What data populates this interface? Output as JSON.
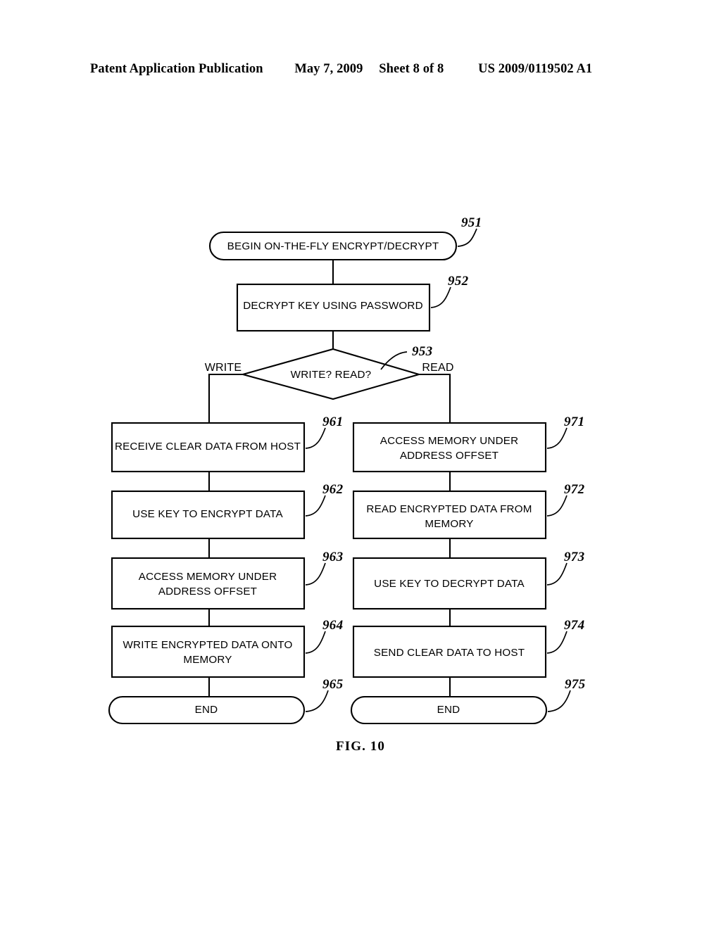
{
  "document": {
    "header": {
      "publication": "Patent Application Publication",
      "date": "May 7, 2009",
      "sheet": "Sheet 8 of 8",
      "patent_number": "US 2009/0119502 A1"
    },
    "figure_caption": "FIG. 10"
  },
  "chart_data": {
    "type": "diagram",
    "diagram_kind": "flowchart",
    "title": "FIG. 10",
    "nodes": [
      {
        "id": "951",
        "ref": "951",
        "shape": "terminator",
        "text": "BEGIN ON-THE-FLY ENCRYPT/DECRYPT",
        "lines": [
          "BEGIN ON-THE-FLY ENCRYPT/DECRYPT"
        ]
      },
      {
        "id": "952",
        "ref": "952",
        "shape": "process",
        "text": "DECRYPT KEY USING PASSWORD",
        "lines": [
          "DECRYPT KEY USING PASSWORD"
        ]
      },
      {
        "id": "953",
        "ref": "953",
        "shape": "decision",
        "text": "WRITE? READ?",
        "lines": [
          "WRITE? READ?"
        ]
      },
      {
        "id": "961",
        "ref": "961",
        "shape": "process",
        "text": "RECEIVE CLEAR DATA FROM HOST",
        "lines": [
          "RECEIVE CLEAR DATA FROM HOST"
        ]
      },
      {
        "id": "962",
        "ref": "962",
        "shape": "process",
        "text": "USE KEY TO ENCRYPT DATA",
        "lines": [
          "USE KEY TO ENCRYPT DATA"
        ]
      },
      {
        "id": "963",
        "ref": "963",
        "shape": "process",
        "text": "ACCESS MEMORY UNDER ADDRESS OFFSET",
        "lines": [
          "ACCESS MEMORY UNDER",
          "ADDRESS OFFSET"
        ]
      },
      {
        "id": "964",
        "ref": "964",
        "shape": "process",
        "text": "WRITE ENCRYPTED DATA ONTO MEMORY",
        "lines": [
          "WRITE ENCRYPTED DATA ONTO",
          "MEMORY"
        ]
      },
      {
        "id": "965",
        "ref": "965",
        "shape": "terminator",
        "text": "END",
        "lines": [
          "END"
        ]
      },
      {
        "id": "971",
        "ref": "971",
        "shape": "process",
        "text": "ACCESS MEMORY UNDER ADDRESS OFFSET",
        "lines": [
          "ACCESS MEMORY UNDER",
          "ADDRESS OFFSET"
        ]
      },
      {
        "id": "972",
        "ref": "972",
        "shape": "process",
        "text": "READ ENCRYPTED DATA FROM MEMORY",
        "lines": [
          "READ ENCRYPTED DATA FROM",
          "MEMORY"
        ]
      },
      {
        "id": "973",
        "ref": "973",
        "shape": "process",
        "text": "USE KEY TO DECRYPT DATA",
        "lines": [
          "USE KEY TO DECRYPT DATA"
        ]
      },
      {
        "id": "974",
        "ref": "974",
        "shape": "process",
        "text": "SEND CLEAR DATA TO HOST",
        "lines": [
          "SEND CLEAR DATA TO HOST"
        ]
      },
      {
        "id": "975",
        "ref": "975",
        "shape": "terminator",
        "text": "END",
        "lines": [
          "END"
        ]
      }
    ],
    "edges": [
      {
        "from": "951",
        "to": "952",
        "label": ""
      },
      {
        "from": "952",
        "to": "953",
        "label": ""
      },
      {
        "from": "953",
        "to": "961",
        "label": "WRITE"
      },
      {
        "from": "953",
        "to": "971",
        "label": "READ"
      },
      {
        "from": "961",
        "to": "962",
        "label": ""
      },
      {
        "from": "962",
        "to": "963",
        "label": ""
      },
      {
        "from": "963",
        "to": "964",
        "label": ""
      },
      {
        "from": "964",
        "to": "965",
        "label": ""
      },
      {
        "from": "971",
        "to": "972",
        "label": ""
      },
      {
        "from": "972",
        "to": "973",
        "label": ""
      },
      {
        "from": "973",
        "to": "974",
        "label": ""
      },
      {
        "from": "974",
        "to": "975",
        "label": ""
      }
    ],
    "branch_labels": {
      "left": "WRITE",
      "right": "READ"
    },
    "colors": {
      "stroke": "#000000",
      "fill": "#ffffff",
      "text": "#000000"
    }
  },
  "nodes": {
    "n951": {
      "text": "BEGIN ON-THE-FLY ENCRYPT/DECRYPT",
      "ref": "951"
    },
    "n952": {
      "text": "DECRYPT KEY USING PASSWORD",
      "ref": "952"
    },
    "n953": {
      "text": "WRITE? READ?",
      "ref": "953"
    },
    "n961": {
      "text": "RECEIVE CLEAR DATA FROM HOST",
      "ref": "961"
    },
    "n962": {
      "text": "USE KEY TO ENCRYPT DATA",
      "ref": "962"
    },
    "n963": {
      "line1": "ACCESS MEMORY UNDER",
      "line2": "ADDRESS OFFSET",
      "ref": "963"
    },
    "n964": {
      "line1": "WRITE ENCRYPTED DATA ONTO",
      "line2": "MEMORY",
      "ref": "964"
    },
    "n965": {
      "text": "END",
      "ref": "965"
    },
    "n971": {
      "line1": "ACCESS MEMORY UNDER",
      "line2": "ADDRESS OFFSET",
      "ref": "971"
    },
    "n972": {
      "line1": "READ ENCRYPTED DATA FROM",
      "line2": "MEMORY",
      "ref": "972"
    },
    "n973": {
      "text": "USE KEY TO DECRYPT DATA",
      "ref": "973"
    },
    "n974": {
      "text": "SEND CLEAR DATA TO HOST",
      "ref": "974"
    },
    "n975": {
      "text": "END",
      "ref": "975"
    }
  },
  "labels": {
    "write_branch": "WRITE",
    "read_branch": "READ"
  }
}
